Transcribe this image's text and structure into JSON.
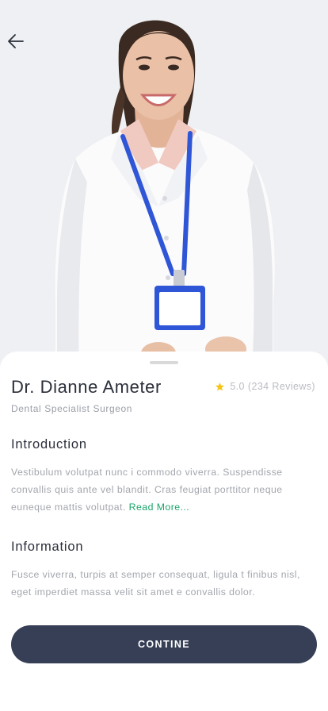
{
  "doctor": {
    "name": "Dr. Dianne Ameter",
    "specialty": "Dental Specialist Surgeon",
    "rating": "5.0",
    "reviews": "(234 Reviews)"
  },
  "introduction": {
    "title": "Introduction",
    "text": "Vestibulum volutpat nunc i commodo viverra. Suspendisse convallis quis ante vel blandit. Cras feugiat porttitor neque euneque mattis volutpat.",
    "read_more": "Read More..."
  },
  "information": {
    "title": "Information",
    "text": "Fusce viverra, turpis at semper consequat, ligula t finibus nisl, eget imperdiet massa velit sit amet e convallis dolor."
  },
  "cta": {
    "label": "CONTINE"
  },
  "colors": {
    "accent": "#1aa66a",
    "button": "#363f55",
    "star": "#f5c518",
    "lanyard": "#2f56d6"
  },
  "icons": {
    "back": "arrow-left-icon",
    "star": "star-icon"
  }
}
